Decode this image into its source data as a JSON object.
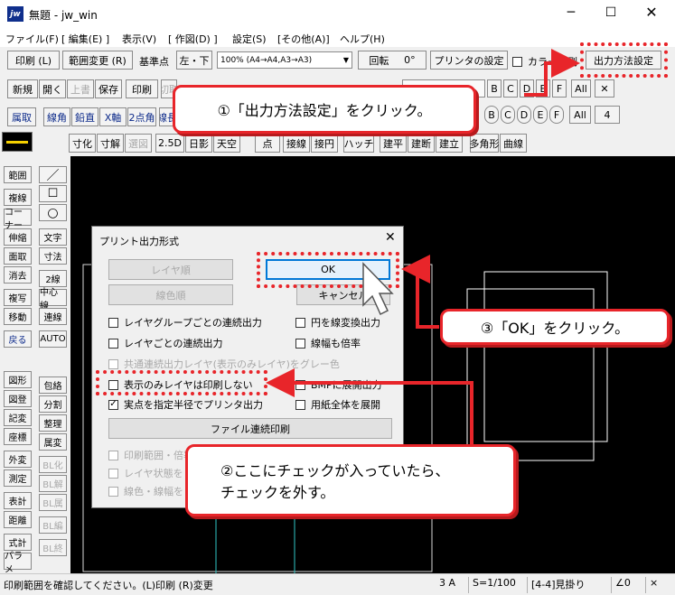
{
  "window": {
    "title": "無題 - jw_win",
    "app_icon": "jw",
    "controls": [
      "minimize",
      "maximize",
      "close"
    ]
  },
  "menubar": [
    "ファイル(F)",
    "[ 編集(E) ]",
    "表示(V)",
    "[ 作図(D) ]",
    "設定(S)",
    "[その他(A)]",
    "ヘルプ(H)"
  ],
  "toolbar1": {
    "print": "印刷 (L)",
    "range_change": "範囲変更 (R)",
    "base_point": "基準点",
    "base_point_value": "左・下",
    "scale_select": "100% (A4→A4,A3→A3)",
    "rotate": "回転",
    "rotate_value": "0°",
    "printer_settings": "プリンタの設定",
    "color_label": "カラー印刷",
    "output_method": "出力方法設定"
  },
  "toolbar2": [
    "新規",
    "開く",
    "上書",
    "保存",
    "印刷",
    "切取"
  ],
  "toolbar3": [
    "属取",
    "線角",
    "鉛直",
    "X軸",
    "2点角",
    "線長"
  ],
  "toolbar4": [
    "寸化",
    "寸解",
    "選図",
    "2.5D",
    "日影",
    "天空",
    "点",
    "接線",
    "接円",
    "ハッチ",
    "建平",
    "建断",
    "建立",
    "多角形",
    "曲線"
  ],
  "layer_right_1": [
    "B",
    "C",
    "D",
    "E",
    "F",
    "All",
    "✕"
  ],
  "layer_right_2": [
    "B",
    "C",
    "D",
    "E",
    "F",
    "All",
    "4"
  ],
  "left_col1": [
    "範囲",
    "複線",
    "コーナー",
    "伸縮",
    "面取",
    "消去",
    "複写",
    "移動",
    "戻る",
    "図形",
    "図登",
    "記変",
    "座標",
    "外変",
    "測定",
    "表計",
    "距離",
    "式計",
    "パラメ"
  ],
  "left_col2": [
    "文字",
    "寸法",
    "2線",
    "中心線",
    "連線",
    "AUTO",
    "包絡",
    "分割",
    "整理",
    "属変",
    "BL化",
    "BL解",
    "BL属",
    "BL編",
    "BL終"
  ],
  "dialog": {
    "title": "プリント出力形式",
    "layer_order": "レイヤ順",
    "line_color_order": "線色順",
    "ok": "OK",
    "cancel": "キャンセル",
    "checks_left": [
      {
        "label": "レイヤグループごとの連続出力",
        "checked": false,
        "disabled": false
      },
      {
        "label": "レイヤごとの連続出力",
        "checked": false,
        "disabled": false
      },
      {
        "label": "共通連続出力レイヤ(表示のみレイヤ)をグレー色",
        "checked": false,
        "disabled": true
      },
      {
        "label": "表示のみレイヤは印刷しない",
        "checked": false,
        "disabled": false
      },
      {
        "label": "実点を指定半径でプリンタ出力",
        "checked": true,
        "disabled": false
      }
    ],
    "checks_right": [
      {
        "label": "円を線変換出力",
        "checked": false
      },
      {
        "label": "線幅も倍率",
        "checked": false
      },
      {
        "label": "BMPに展開出力",
        "checked": false
      },
      {
        "label": "用紙全体を展開",
        "checked": false
      }
    ],
    "file_batch_print": "ファイル連続印刷",
    "bottom_checks": [
      "印刷範囲・倍率",
      "レイヤ状態を",
      "線色・線幅を"
    ]
  },
  "callouts": {
    "step1": "①「出力方法設定」をクリック。",
    "step2_line1": "②ここにチェックが入っていたら、",
    "step2_line2": "チェックを外す。",
    "step3": "③「OK」をクリック。"
  },
  "status": {
    "message": "印刷範囲を確認してください。(L)印刷 (R)変更",
    "paper": "3 A",
    "scale": "S=1/100",
    "mode": "[4-4]見掛り",
    "angle": "∠0",
    "x": "×"
  },
  "colors": {
    "accent_red": "#e8252a",
    "canvas": "#000000",
    "link_blue": "#0c2a8a"
  }
}
